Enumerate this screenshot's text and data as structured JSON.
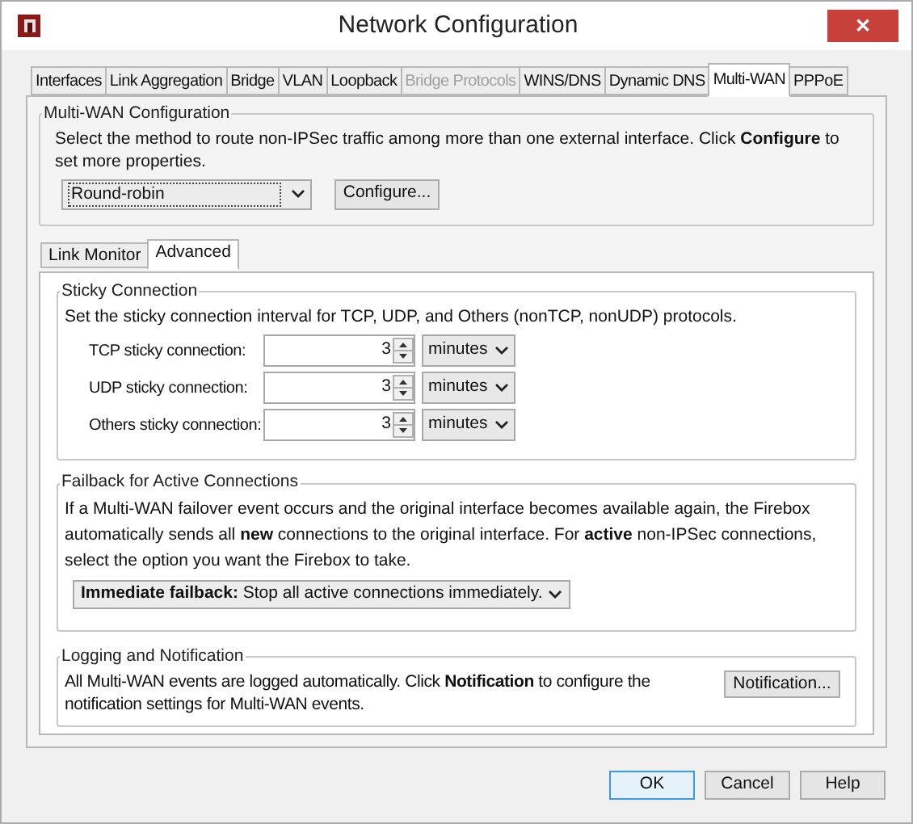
{
  "window": {
    "title": "Network Configuration",
    "close": "✕"
  },
  "tabs": [
    {
      "label": "Interfaces",
      "selected": false,
      "disabled": false
    },
    {
      "label": "Link Aggregation",
      "selected": false,
      "disabled": false
    },
    {
      "label": "Bridge",
      "selected": false,
      "disabled": false
    },
    {
      "label": "VLAN",
      "selected": false,
      "disabled": false
    },
    {
      "label": "Loopback",
      "selected": false,
      "disabled": false
    },
    {
      "label": "Bridge Protocols",
      "selected": false,
      "disabled": true
    },
    {
      "label": "WINS/DNS",
      "selected": false,
      "disabled": false
    },
    {
      "label": "Dynamic DNS",
      "selected": false,
      "disabled": false
    },
    {
      "label": "Multi-WAN",
      "selected": true,
      "disabled": false
    },
    {
      "label": "PPPoE",
      "selected": false,
      "disabled": false
    }
  ],
  "multi_wan": {
    "title": "Multi-WAN Configuration",
    "description": "Select the method to route non-IPSec traffic among more than one external interface. Click **Configure** to set more properties.",
    "method": "Round-robin",
    "configure_button": "Configure..."
  },
  "subtabs": [
    {
      "label": "Link Monitor",
      "selected": false
    },
    {
      "label": "Advanced",
      "selected": true
    }
  ],
  "sticky": {
    "title": "Sticky Connection",
    "description": "Set the sticky connection interval for TCP, UDP, and Others (nonTCP, nonUDP) protocols.",
    "rows": [
      {
        "label": "TCP sticky connection:",
        "value": "3",
        "unit": "minutes"
      },
      {
        "label": "UDP sticky connection:",
        "value": "3",
        "unit": "minutes"
      },
      {
        "label": "Others sticky connection:",
        "value": "3",
        "unit": "minutes"
      }
    ]
  },
  "failback": {
    "title": "Failback for Active Connections",
    "description": "If a Multi-WAN failover event occurs and the original interface becomes available again, the Firebox automatically sends all **new** connections to the original interface. For **active** non-IPSec connections, select the option you want the Firebox to take.",
    "option": "**Immediate failback:** Stop all active connections immediately."
  },
  "logging": {
    "title": "Logging and Notification",
    "description": "All Multi-WAN events are logged automatically. Click **Notification** to configure the notification settings for Multi-WAN events.",
    "button": "Notification..."
  },
  "buttons": [
    {
      "label": "OK",
      "default": true
    },
    {
      "label": "Cancel",
      "default": false
    },
    {
      "label": "Help",
      "default": false
    }
  ]
}
